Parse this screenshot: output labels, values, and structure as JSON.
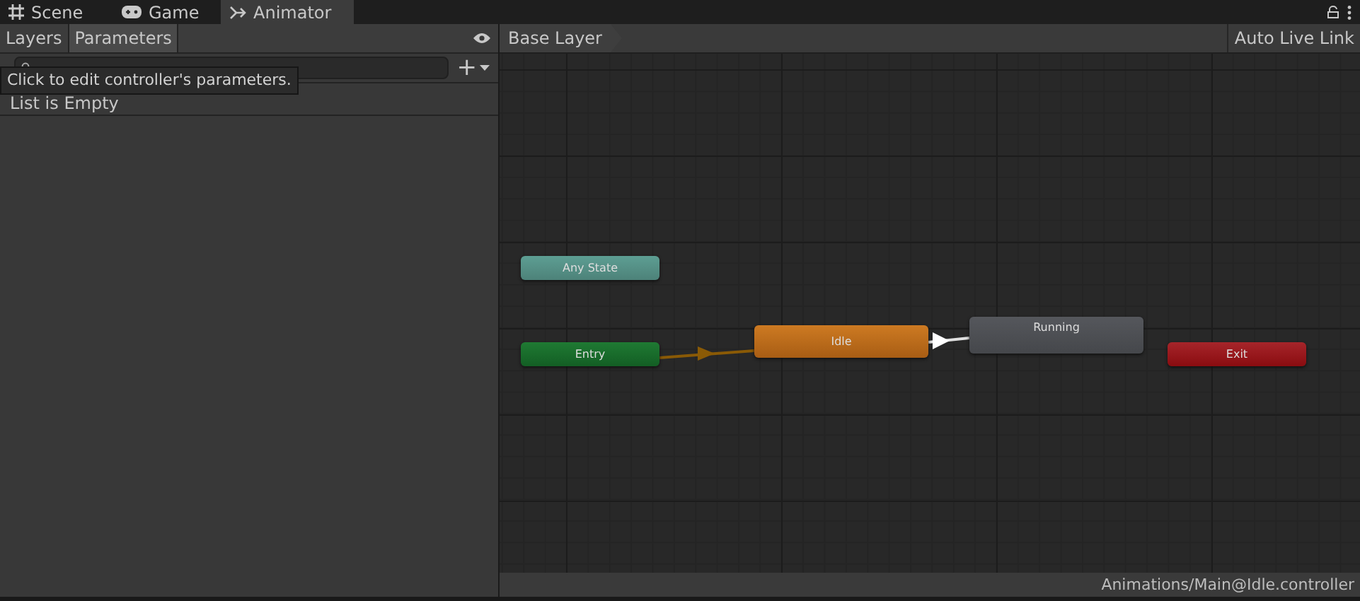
{
  "window_tabs": [
    {
      "label": "Scene",
      "selected": false
    },
    {
      "label": "Game",
      "selected": false
    },
    {
      "label": "Animator",
      "selected": true
    }
  ],
  "side_panel": {
    "tabs": [
      {
        "label": "Layers",
        "selected": false
      },
      {
        "label": "Parameters",
        "selected": true
      }
    ],
    "add_button": "+",
    "list_message": "List is Empty"
  },
  "tooltip": "Click to edit controller's parameters.",
  "breadcrumb": "Base Layer",
  "auto_live_link": "Auto Live Link",
  "states": [
    {
      "label": "Any State",
      "kind": "any"
    },
    {
      "label": "Entry",
      "kind": "entry"
    },
    {
      "label": "Idle",
      "kind": "default"
    },
    {
      "label": "Running",
      "kind": "normal"
    },
    {
      "label": "Exit",
      "kind": "exit"
    }
  ],
  "status_bar": "Animations/Main@Idle.controller"
}
